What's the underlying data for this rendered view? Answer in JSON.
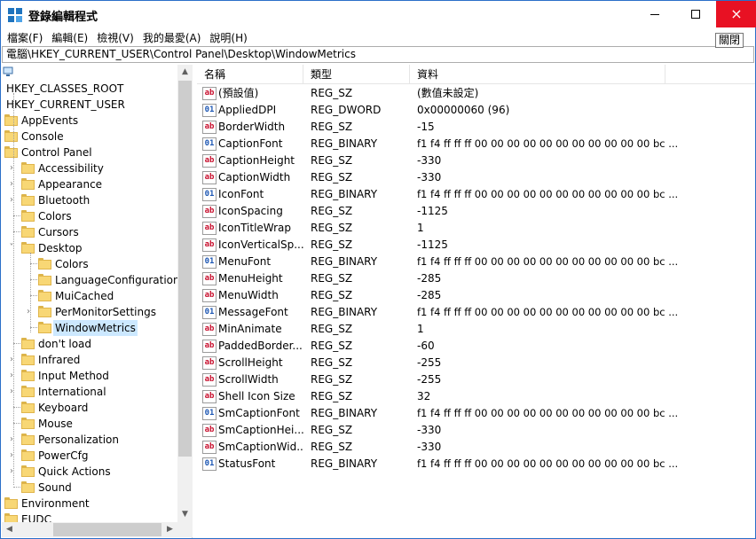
{
  "window": {
    "title": "登錄編輯程式",
    "close_tooltip": "關閉",
    "minimize_glyph": "minimize-icon",
    "maximize_glyph": "maximize-icon",
    "close_glyph": "×"
  },
  "menu": [
    "檔案(F)",
    "編輯(E)",
    "檢視(V)",
    "我的最愛(A)",
    "說明(H)"
  ],
  "address": "電腦\\HKEY_CURRENT_USER\\Control Panel\\Desktop\\WindowMetrics",
  "tree": {
    "root_label": "電腦",
    "items": [
      {
        "label": "HKEY_CLASSES_ROOT",
        "level": 0,
        "expander": "",
        "folder": false
      },
      {
        "label": "HKEY_CURRENT_USER",
        "level": 0,
        "expander": "",
        "folder": false
      },
      {
        "label": "AppEvents",
        "level": 1,
        "expander": "",
        "folder": true
      },
      {
        "label": "Console",
        "level": 1,
        "expander": "",
        "folder": true
      },
      {
        "label": "Control Panel",
        "level": 1,
        "expander": "",
        "folder": true
      },
      {
        "label": "Accessibility",
        "level": 2,
        "expander": ">",
        "folder": true
      },
      {
        "label": "Appearance",
        "level": 2,
        "expander": ">",
        "folder": true
      },
      {
        "label": "Bluetooth",
        "level": 2,
        "expander": ">",
        "folder": true
      },
      {
        "label": "Colors",
        "level": 2,
        "expander": "",
        "folder": true
      },
      {
        "label": "Cursors",
        "level": 2,
        "expander": "",
        "folder": true
      },
      {
        "label": "Desktop",
        "level": 2,
        "expander": "v",
        "folder": true
      },
      {
        "label": "Colors",
        "level": 3,
        "expander": "",
        "folder": true
      },
      {
        "label": "LanguageConfiguration",
        "level": 3,
        "expander": "",
        "folder": true
      },
      {
        "label": "MuiCached",
        "level": 3,
        "expander": "",
        "folder": true
      },
      {
        "label": "PerMonitorSettings",
        "level": 3,
        "expander": ">",
        "folder": true
      },
      {
        "label": "WindowMetrics",
        "level": 3,
        "expander": "",
        "folder": true,
        "selected": true
      },
      {
        "label": "don't load",
        "level": 2,
        "expander": "",
        "folder": true
      },
      {
        "label": "Infrared",
        "level": 2,
        "expander": ">",
        "folder": true
      },
      {
        "label": "Input Method",
        "level": 2,
        "expander": ">",
        "folder": true
      },
      {
        "label": "International",
        "level": 2,
        "expander": ">",
        "folder": true
      },
      {
        "label": "Keyboard",
        "level": 2,
        "expander": "",
        "folder": true
      },
      {
        "label": "Mouse",
        "level": 2,
        "expander": "",
        "folder": true
      },
      {
        "label": "Personalization",
        "level": 2,
        "expander": ">",
        "folder": true
      },
      {
        "label": "PowerCfg",
        "level": 2,
        "expander": ">",
        "folder": true
      },
      {
        "label": "Quick Actions",
        "level": 2,
        "expander": ">",
        "folder": true
      },
      {
        "label": "Sound",
        "level": 2,
        "expander": "",
        "folder": true
      },
      {
        "label": "Environment",
        "level": 1,
        "expander": "",
        "folder": true
      },
      {
        "label": "EUDC",
        "level": 1,
        "expander": "",
        "folder": true
      }
    ]
  },
  "list": {
    "columns": [
      "名稱",
      "類型",
      "資料"
    ],
    "rows": [
      {
        "icon": "ab",
        "name": "(預設值)",
        "type": "REG_SZ",
        "data": "(數值未設定)"
      },
      {
        "icon": "bin",
        "name": "AppliedDPI",
        "type": "REG_DWORD",
        "data": "0x00000060 (96)"
      },
      {
        "icon": "ab",
        "name": "BorderWidth",
        "type": "REG_SZ",
        "data": "-15"
      },
      {
        "icon": "bin",
        "name": "CaptionFont",
        "type": "REG_BINARY",
        "data": "f1 f4 ff ff ff 00 00 00 00 00 00 00 00 00 00 00 bc ..."
      },
      {
        "icon": "ab",
        "name": "CaptionHeight",
        "type": "REG_SZ",
        "data": "-330"
      },
      {
        "icon": "ab",
        "name": "CaptionWidth",
        "type": "REG_SZ",
        "data": "-330"
      },
      {
        "icon": "bin",
        "name": "IconFont",
        "type": "REG_BINARY",
        "data": "f1 f4 ff ff ff 00 00 00 00 00 00 00 00 00 00 00 bc ..."
      },
      {
        "icon": "ab",
        "name": "IconSpacing",
        "type": "REG_SZ",
        "data": "-1125"
      },
      {
        "icon": "ab",
        "name": "IconTitleWrap",
        "type": "REG_SZ",
        "data": "1"
      },
      {
        "icon": "ab",
        "name": "IconVerticalSp...",
        "type": "REG_SZ",
        "data": "-1125"
      },
      {
        "icon": "bin",
        "name": "MenuFont",
        "type": "REG_BINARY",
        "data": "f1 f4 ff ff ff 00 00 00 00 00 00 00 00 00 00 00 bc ..."
      },
      {
        "icon": "ab",
        "name": "MenuHeight",
        "type": "REG_SZ",
        "data": "-285"
      },
      {
        "icon": "ab",
        "name": "MenuWidth",
        "type": "REG_SZ",
        "data": "-285"
      },
      {
        "icon": "bin",
        "name": "MessageFont",
        "type": "REG_BINARY",
        "data": "f1 f4 ff ff ff 00 00 00 00 00 00 00 00 00 00 00 bc ..."
      },
      {
        "icon": "ab",
        "name": "MinAnimate",
        "type": "REG_SZ",
        "data": "1"
      },
      {
        "icon": "ab",
        "name": "PaddedBorder...",
        "type": "REG_SZ",
        "data": "-60"
      },
      {
        "icon": "ab",
        "name": "ScrollHeight",
        "type": "REG_SZ",
        "data": "-255"
      },
      {
        "icon": "ab",
        "name": "ScrollWidth",
        "type": "REG_SZ",
        "data": "-255"
      },
      {
        "icon": "ab",
        "name": "Shell Icon Size",
        "type": "REG_SZ",
        "data": "32"
      },
      {
        "icon": "bin",
        "name": "SmCaptionFont",
        "type": "REG_BINARY",
        "data": "f1 f4 ff ff ff 00 00 00 00 00 00 00 00 00 00 00 bc ..."
      },
      {
        "icon": "ab",
        "name": "SmCaptionHei...",
        "type": "REG_SZ",
        "data": "-330"
      },
      {
        "icon": "ab",
        "name": "SmCaptionWid...",
        "type": "REG_SZ",
        "data": "-330"
      },
      {
        "icon": "bin",
        "name": "StatusFont",
        "type": "REG_BINARY",
        "data": "f1 f4 ff ff ff 00 00 00 00 00 00 00 00 00 00 00 bc ..."
      }
    ]
  }
}
